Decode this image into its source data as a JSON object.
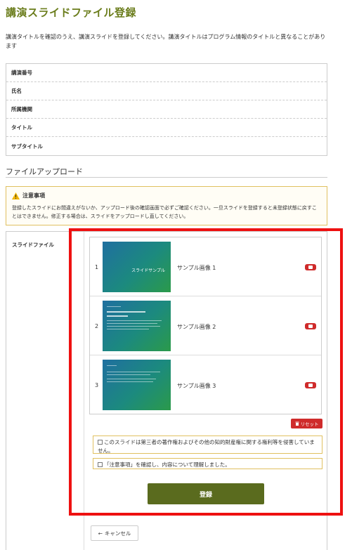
{
  "page": {
    "title": "講演スライドファイル登録",
    "intro": "講演タイトルを確認のうえ、講演スライドを登録してください。講演タイトルはプログラム情報のタイトルと異なることがあります"
  },
  "info_table": {
    "rows": [
      "講演番号",
      "氏名",
      "所属機関",
      "タイトル",
      "サブタイトル"
    ]
  },
  "upload": {
    "section_title": "ファイルアップロード",
    "notice_title": "注意事項",
    "notice_text": "登録したスライドにお間違えがないか、アップロード後の確認画面で必ずご確認ください。一旦スライドを登録すると未登録状態に戻すことはできません。修正する場合は、スライドをアップロードし直してください。",
    "field_label": "スライドファイル",
    "slides": [
      {
        "num": "1",
        "name": "サンプル画像 1",
        "thumb_title": "スライドサンプル"
      },
      {
        "num": "2",
        "name": "サンプル画像 2",
        "thumb_title": ""
      },
      {
        "num": "3",
        "name": "サンプル画像 3",
        "thumb_title": ""
      }
    ],
    "reset_label": "リセット",
    "check1_text": "このスライドは第三者の著作権およびその他の知的財産権に関する権利等を侵害していません。",
    "check2_text": "「注意事項」を確認し、内容について理解しました。",
    "submit_label": "登録",
    "cancel_label": "キャンセル"
  },
  "colors": {
    "accent": "#6b7d1c",
    "submit": "#5a6b1e",
    "danger": "#cf2b2b",
    "highlight": "#ee1111"
  }
}
